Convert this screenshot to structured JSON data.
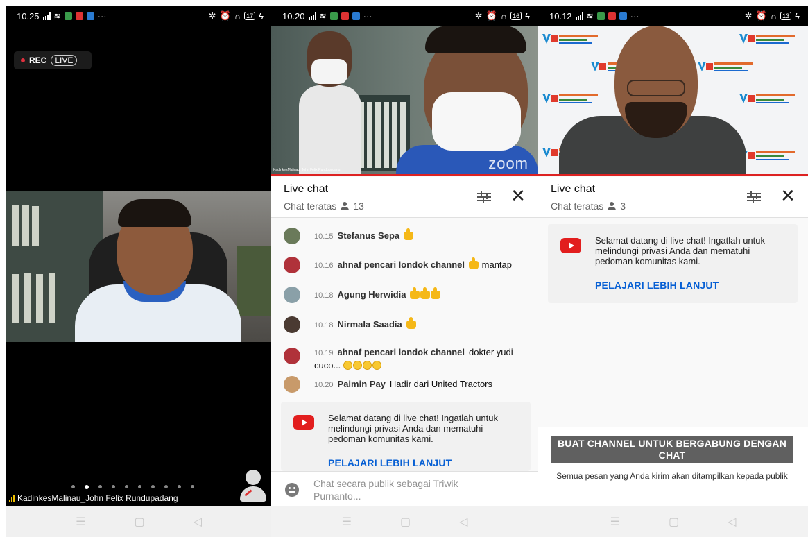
{
  "panels": {
    "one": {
      "status_time": "10.25",
      "battery": "17",
      "rec_label": "REC",
      "live_label": "LIVE",
      "participant_name": "KadinkesMalinau_John Felix Rundupadang"
    },
    "two": {
      "status_time": "10.20",
      "battery": "16",
      "zoom_watermark": "zoom",
      "video_caption": "KadinkesMalinau_John Felix Rundupadang",
      "chat_title": "Live chat",
      "chat_mode": "Chat teratas",
      "viewer_count": "13",
      "messages": [
        {
          "time": "10.15",
          "author": "Stefanus Sepa",
          "text": "",
          "emoji": "thumb",
          "emoji_count": 1
        },
        {
          "time": "10.16",
          "author": "ahnaf pencari londok channel",
          "text": "mantap",
          "emoji": "thumb",
          "emoji_count": 1
        },
        {
          "time": "10.18",
          "author": "Agung Herwidia",
          "text": "",
          "emoji": "thumb",
          "emoji_count": 3
        },
        {
          "time": "10.18",
          "author": "Nirmala Saadia",
          "text": "",
          "emoji": "thumb",
          "emoji_count": 1
        },
        {
          "time": "10.19",
          "author": "ahnaf pencari londok channel",
          "text": "dokter yudi cuco...",
          "emoji": "smile",
          "emoji_count": 4
        },
        {
          "time": "10.20",
          "author": "Paimin Pay",
          "text": "Hadir dari United Tractors",
          "emoji": "",
          "emoji_count": 0
        }
      ],
      "welcome_text": "Selamat datang di live chat! Ingatlah untuk melindungi privasi Anda dan mematuhi pedoman komunitas kami.",
      "learn_more": "PELAJARI LEBIH LANJUT",
      "input_placeholder": "Chat secara publik sebagai Triwik Purnanto..."
    },
    "three": {
      "status_time": "10.12",
      "battery": "13",
      "chat_title": "Live chat",
      "chat_mode": "Chat teratas",
      "viewer_count": "3",
      "welcome_text": "Selamat datang di live chat! Ingatlah untuk melindungi privasi Anda dan mematuhi pedoman komunitas kami.",
      "learn_more": "PELAJARI LEBIH LANJUT",
      "create_channel_button": "BUAT CHANNEL UNTUK BERGABUNG DENGAN CHAT",
      "public_note": "Semua pesan yang Anda kirim akan ditampilkan kepada publik"
    }
  },
  "icons": {
    "nav_menu": "menu-icon",
    "nav_home": "home-icon",
    "nav_back": "back-icon"
  },
  "colors": {
    "link_blue": "#065fd4",
    "youtube_red": "#e21e1e",
    "progress_red": "#dd2222"
  }
}
